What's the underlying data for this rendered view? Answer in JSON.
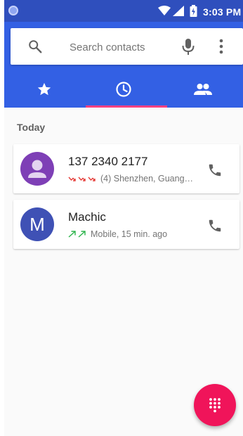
{
  "status_bar": {
    "time": "3:03 PM"
  },
  "search": {
    "placeholder": "Search contacts"
  },
  "tabs": [
    {
      "id": "favorites",
      "icon": "star-icon",
      "selected": false
    },
    {
      "id": "recents",
      "icon": "clock-icon",
      "selected": true
    },
    {
      "id": "contacts",
      "icon": "people-icon",
      "selected": false
    }
  ],
  "recents": {
    "section_label": "Today",
    "calls": [
      {
        "name": "137 2340 2177",
        "details": "(4) Shenzhen, Guang…",
        "call_type_icons": [
          "missed-call-icon",
          "missed-call-icon",
          "missed-call-icon"
        ],
        "avatar": {
          "type": "person-icon",
          "color": "#7e3fb6"
        }
      },
      {
        "name": "Machic",
        "details": "Mobile, 15 min. ago",
        "call_type_icons": [
          "outgoing-call-icon",
          "outgoing-call-icon"
        ],
        "avatar": {
          "type": "letter",
          "letter": "M",
          "color": "#3f51b5"
        }
      }
    ]
  },
  "colors": {
    "status_bar": "#2f4fbd",
    "app_bar": "#3360e4",
    "tab_indicator": "#ff4081",
    "fab": "#f0145a",
    "missed": "#e53935",
    "outgoing": "#2bb34a"
  },
  "fab": {
    "icon": "dialpad-icon"
  }
}
